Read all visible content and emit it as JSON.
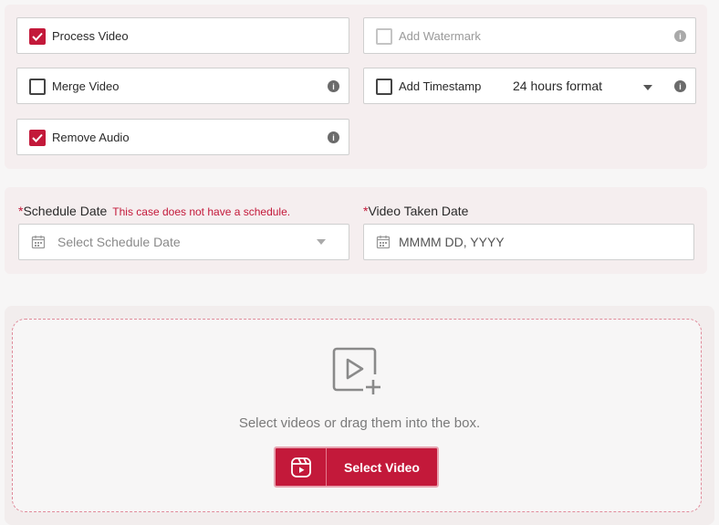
{
  "options": {
    "process_video": {
      "label": "Process Video",
      "checked": true
    },
    "add_watermark": {
      "label": "Add Watermark",
      "checked": false,
      "disabled": true
    },
    "merge_video": {
      "label": "Merge Video",
      "checked": false
    },
    "add_timestamp": {
      "label": "Add Timestamp",
      "checked": false,
      "format_value": "24 hours format"
    },
    "remove_audio": {
      "label": "Remove Audio",
      "checked": true
    },
    "info_icon_text": "i"
  },
  "schedule": {
    "required_mark": "*",
    "label": "Schedule Date",
    "note": "This case does not have a schedule.",
    "placeholder": "Select Schedule Date"
  },
  "video_taken": {
    "required_mark": "*",
    "label": "Video Taken Date",
    "placeholder": "MMMM DD, YYYY"
  },
  "upload": {
    "instruction": "Select videos or drag them into the box.",
    "button_label": "Select Video"
  },
  "colors": {
    "accent": "#c3193a",
    "panel_bg": "#f5eeef",
    "dropzone_border": "#e08a9a"
  },
  "icons": {
    "check": "check-icon",
    "info": "info-icon",
    "calendar": "calendar-icon",
    "caret": "chevron-down-icon",
    "upload": "video-add-icon",
    "reel": "video-reel-icon"
  }
}
